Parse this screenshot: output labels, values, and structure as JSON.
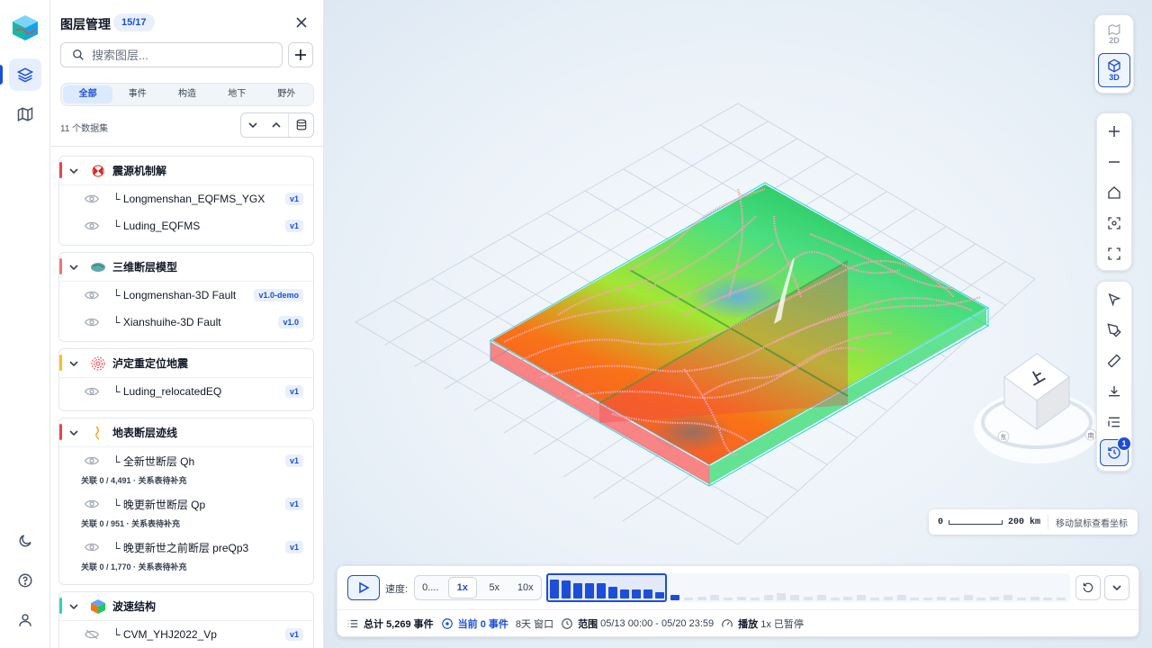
{
  "panel": {
    "title": "图层管理",
    "count": "15/17",
    "search_placeholder": "搜索图层...",
    "tabs": [
      "全部",
      "事件",
      "构造",
      "地下",
      "野外"
    ],
    "dataset_count": "11 个数据集"
  },
  "groups": [
    {
      "name": "震源机制解",
      "color": "#ef4444",
      "layers": [
        {
          "name": "└ Longmenshan_EQFMS_YGX",
          "version": "v1"
        },
        {
          "name": "└ Luding_EQFMS",
          "version": "v1"
        }
      ]
    },
    {
      "name": "三维断层模型",
      "color": "#f87171",
      "layers": [
        {
          "name": "└ Longmenshan-3D Fault",
          "version": "v1.0-demo"
        },
        {
          "name": "└ Xianshuihe-3D Fault",
          "version": "v1.0"
        }
      ]
    },
    {
      "name": "泸定重定位地震",
      "color": "#fbbf24",
      "layers": [
        {
          "name": "└ Luding_relocatedEQ",
          "version": "v1"
        }
      ]
    },
    {
      "name": "地表断层迹线",
      "color": "#ef4444",
      "layers": [
        {
          "name": "└ 全新世断层 Qh",
          "version": "v1",
          "relation": "关联 0 / 4,491 · 关系表待补充"
        },
        {
          "name": "└ 晚更新世断层 Qp",
          "version": "v1",
          "relation": "关联 0 / 951 · 关系表待补充"
        },
        {
          "name": "└ 晚更新世之前断层 preQp3",
          "version": "v1",
          "relation": "关联 0 / 1,770 · 关系表待补充"
        }
      ]
    },
    {
      "name": "波速结构",
      "color": "#2dd4bf",
      "layers": [
        {
          "name": "└ CVM_YHJ2022_Vp",
          "version": "v1"
        }
      ]
    }
  ],
  "view": {
    "mode_2d": "2D",
    "mode_3d": "3D",
    "history_badge": "1"
  },
  "compass": {
    "top_face": "上",
    "east": "东",
    "south": "南"
  },
  "scale": {
    "zero": "0",
    "distance": "200 km",
    "coord_hint": "移动鼠标查看坐标"
  },
  "timeline": {
    "speed_label": "速度:",
    "speeds": [
      "0....",
      "1x",
      "5x",
      "10x"
    ],
    "selected_speed": "1x",
    "histogram_highlight": [
      0.75,
      0.7,
      0.6,
      0.6,
      0.6,
      0.45,
      0.35,
      0.35,
      0.35,
      0.25
    ],
    "histogram_rest": [
      0.2,
      0.1,
      0.15,
      0.2,
      0.1,
      0.15,
      0.1,
      0.2,
      0.3,
      0.2,
      0.15,
      0.2,
      0.1,
      0.15,
      0.2,
      0.1,
      0.15,
      0.2,
      0.1,
      0.1,
      0.15,
      0.1,
      0.2,
      0.1,
      0.15,
      0.2,
      0.1,
      0.15,
      0.1,
      0.1
    ],
    "total_label": "总计",
    "total_value": "5,269 事件",
    "current": "当前 0 事件",
    "window": "8天 窗口",
    "range_label": "范围",
    "range_value": "05/13 00:00 - 05/20 23:59",
    "play_label": "播放",
    "play_state": "1x 已暂停"
  }
}
